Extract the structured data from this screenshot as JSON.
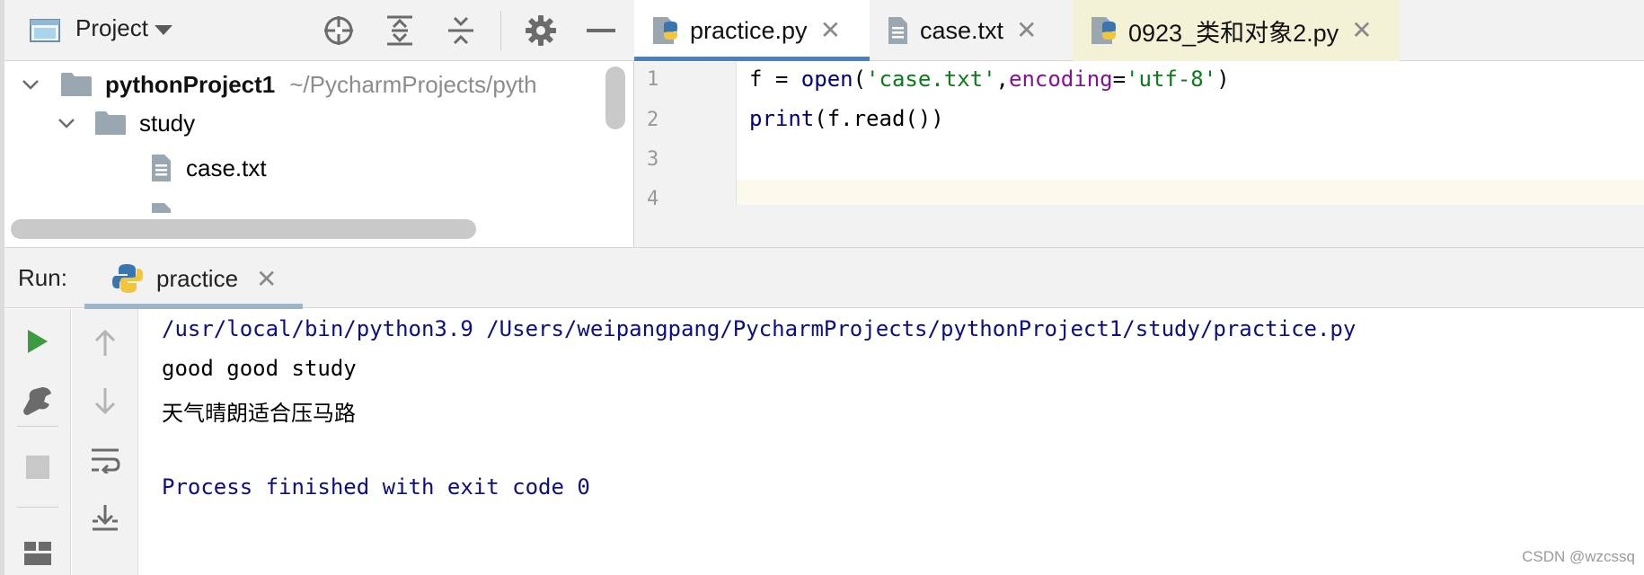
{
  "project_panel": {
    "view_label": "Project",
    "tree": [
      {
        "name": "pythonProject1",
        "path": "~/PycharmProjects/pyth"
      },
      {
        "name": "study"
      },
      {
        "name": "case.txt"
      }
    ]
  },
  "editor": {
    "tabs": [
      {
        "label": "practice.py",
        "icon": "python-file-icon",
        "active": true
      },
      {
        "label": "case.txt",
        "icon": "text-file-icon",
        "active": false
      },
      {
        "label": "0923_类和对象2.py",
        "icon": "python-file-icon",
        "active": false
      }
    ],
    "line_numbers": [
      "1",
      "2",
      "3",
      "4"
    ],
    "code": {
      "line1": {
        "t1": "f = ",
        "t2": "open",
        "t3": "(",
        "t4": "'case.txt'",
        "t5": ",",
        "t6": "encoding",
        "t7": "=",
        "t8": "'utf-8'",
        "t9": ")"
      },
      "line2": {
        "t1": "print",
        "t2": "(f.read())"
      }
    }
  },
  "run_panel": {
    "title": "Run:",
    "tab_label": "practice",
    "console": [
      "/usr/local/bin/python3.9 /Users/weipangpang/PycharmProjects/pythonProject1/study/practice.py",
      "good good study",
      "天气晴朗适合压马路",
      "",
      "Process finished with exit code 0"
    ]
  },
  "watermark": "CSDN @wzcssq",
  "colors": {
    "keyword_purple": "#871094",
    "string_green": "#067d17",
    "builtin_blue": "#000080",
    "run_green": "#3c9a3f",
    "active_tab_underline": "#4083c9"
  }
}
